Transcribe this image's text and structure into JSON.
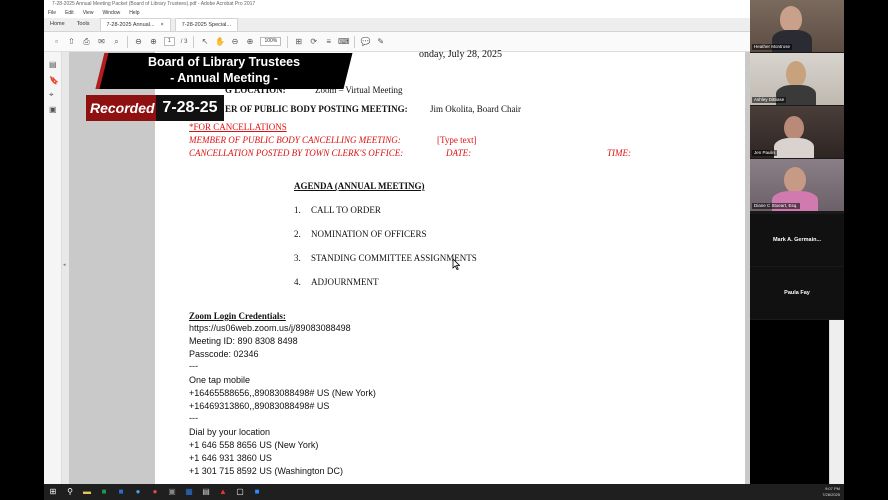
{
  "window": {
    "title": "7-28-2025 Annual Meeting Packet (Board of Library Trustees).pdf - Adobe Acrobat Pro 2017",
    "menu": [
      "File",
      "Edit",
      "View",
      "Window",
      "Help"
    ],
    "tabs": [
      {
        "label": "Home"
      },
      {
        "label": "Tools"
      },
      {
        "label": "7-28-2025 Annual..."
      },
      {
        "label": "7-28-2025 Special..."
      }
    ],
    "page_current": "1",
    "page_total": "/ 3",
    "zoom": "100%"
  },
  "overlay": {
    "banner_line1": "Board of Library Trustees",
    "banner_line2": "- Annual Meeting -",
    "recorded": "Recorded",
    "date": "7-28-25"
  },
  "document": {
    "heading_partial": "onday, July 28, 2025",
    "location_label": "G LOCATION:",
    "location_value": "Zoom – Virtual Meeting",
    "posting_label": "ER OF PUBLIC BODY POSTING MEETING:",
    "posting_value": "Jim Okolita, Board Chair",
    "cancellations": "*FOR CANCELLATIONS",
    "cancel_member_label": "MEMBER  OF PUBLIC BODY CANCELLING MEETING:",
    "cancel_member_value": "[Type text]",
    "cancel_posted": "CANCELLATION  POSTED BY TOWN CLERK'S OFFICE:",
    "cancel_date": "DATE:",
    "cancel_time": "TIME:",
    "agenda_title": "AGENDA (ANNUAL MEETING)",
    "agenda": [
      {
        "num": "1.",
        "text": "CALL TO ORDER"
      },
      {
        "num": "2.",
        "text": "NOMINATION  OF OFFICERS"
      },
      {
        "num": "3.",
        "text": "STANDING COMMITTEE  ASSIGNMENTS"
      },
      {
        "num": "4.",
        "text": "ADJOURNMENT"
      }
    ],
    "zoom_title": "Zoom Login Credentials:",
    "zoom_lines": [
      "https://us06web.zoom.us/j/89083088498",
      "Meeting ID: 890 8308 8498",
      "Passcode: 02346",
      "---",
      "One tap mobile",
      "+16465588656,,89083088498#  US (New York)",
      "+16469313860,,89083088498#  US",
      "---",
      "Dial by your location",
      "+1 646 558 8656 US (New York)",
      "+1 646 931 3860 US",
      "+1 301 715 8592 US (Washington DC)"
    ]
  },
  "participants": [
    {
      "name": "Heather Montrose",
      "video": true
    },
    {
      "name": "Ashley DiBiase",
      "video": true
    },
    {
      "name": "Jen Paulin",
      "video": true
    },
    {
      "name": "Diane C Stoeart, Esq.",
      "video": true
    },
    {
      "name": "Mark A. Germain...",
      "video": false
    },
    {
      "name": "Paula Fay",
      "video": false
    }
  ],
  "taskbar": {
    "time": "9:07 PM",
    "date": "7/28/2025"
  },
  "colors": {
    "banner_red": "#8e1010",
    "doc_red": "#dd1111"
  }
}
